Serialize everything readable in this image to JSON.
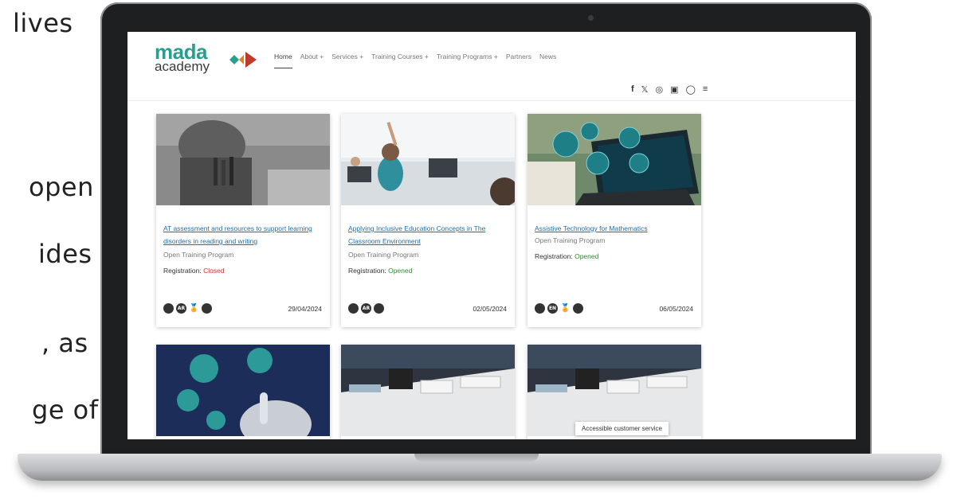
{
  "side_text": [
    "lives",
    "open",
    "ides",
    ", as",
    "ge of"
  ],
  "logo": {
    "line1": "mada",
    "line2": "academy"
  },
  "nav": [
    {
      "label": "Home",
      "active": true
    },
    {
      "label": "About +"
    },
    {
      "label": "Services +"
    },
    {
      "label": "Training Courses +"
    },
    {
      "label": "Training Programs +"
    },
    {
      "label": "Partners"
    },
    {
      "label": "News"
    }
  ],
  "social": [
    "facebook-icon",
    "x-icon",
    "instagram-icon",
    "youtube-icon",
    "github-icon",
    "menu-icon"
  ],
  "social_glyphs": [
    "f",
    "𝕏",
    "◎",
    "▣",
    "◯",
    "≡"
  ],
  "cards": [
    {
      "title": "AT assessment and resources to support learning disorders in reading and writing",
      "type": "Open Training Program",
      "registration_label": "Registration:",
      "registration_status": "Closed",
      "badges": [
        "",
        "AR",
        "🏅",
        ""
      ],
      "date": "29/04/2024"
    },
    {
      "title": "Applying Inclusive Education Concepts in The Classroom Environment",
      "type": "Open Training Program",
      "registration_label": "Registration:",
      "registration_status": "Opened",
      "badges": [
        "",
        "AR",
        ""
      ],
      "date": "02/05/2024"
    },
    {
      "title": "Assistive Technology for Mathematics",
      "type": "Open Training Program",
      "registration_label": "Registration:",
      "registration_status": "Opened",
      "badges": [
        "",
        "EN",
        "🏅",
        ""
      ],
      "date": "06/05/2024"
    }
  ],
  "tooltip": "Accessible customer service",
  "colors": {
    "brand_teal": "#2a9d8f",
    "brand_red": "#c0392b",
    "link": "#1f6fa8",
    "closed": "#d32f2f",
    "opened": "#2e8b2e"
  }
}
